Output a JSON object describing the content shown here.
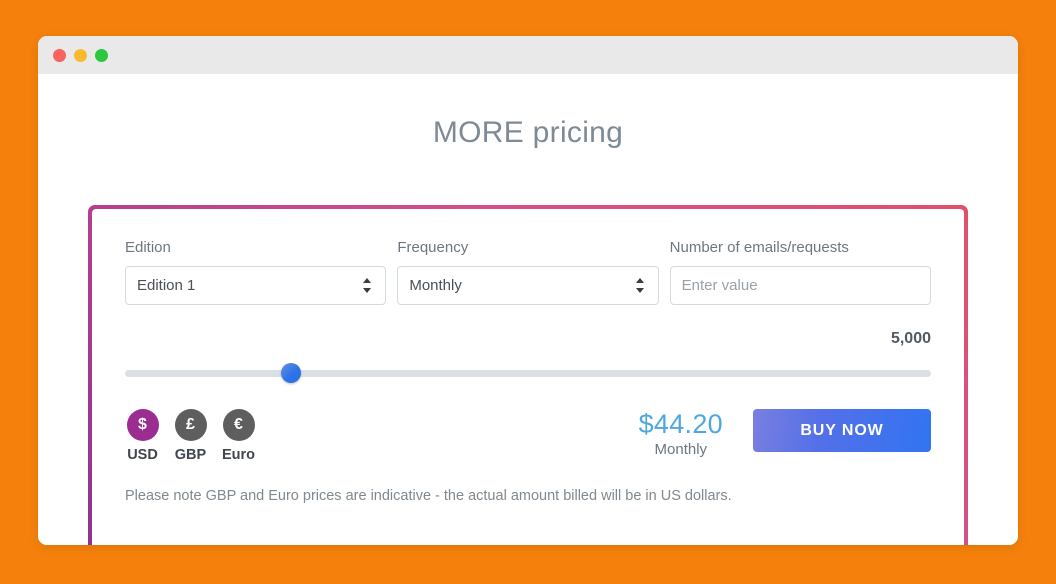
{
  "background_color": "#F5810C",
  "window": {
    "traffic_lights": [
      {
        "name": "close",
        "color": "#f9625e"
      },
      {
        "name": "minimize",
        "color": "#f9bb2d"
      },
      {
        "name": "zoom",
        "color": "#2cc63f"
      }
    ]
  },
  "page": {
    "title": "MORE pricing"
  },
  "card": {
    "border_gradient": [
      "#e0516b",
      "#8e3290"
    ],
    "fields": [
      {
        "label": "Edition",
        "type": "select",
        "value": "Edition 1",
        "icon": "updown-chevron-icon"
      },
      {
        "label": "Frequency",
        "type": "select",
        "value": "Monthly",
        "icon": "updown-chevron-icon"
      },
      {
        "label": "Number of emails/requests",
        "type": "text",
        "value": "",
        "placeholder": "Enter value"
      }
    ],
    "slider": {
      "value_label": "5,000",
      "thumb_percent": 20.6,
      "track_color": "#dcdfe3",
      "thumb_color": "#2f73e8"
    },
    "currencies": [
      {
        "code": "USD",
        "symbol": "$",
        "active": true,
        "color": "#9b2d90"
      },
      {
        "code": "GBP",
        "symbol": "£",
        "active": false,
        "color": "#5e5e5e"
      },
      {
        "code": "Euro",
        "symbol": "€",
        "active": false,
        "color": "#5e5e5e"
      }
    ],
    "price": {
      "amount": "$44.20",
      "period": "Monthly",
      "color": "#4fa7e0"
    },
    "buy_button": {
      "label": "BUY NOW",
      "gradient": [
        "#7a7fe0",
        "#3174f2"
      ]
    },
    "note": "Please note GBP and Euro prices are indicative - the actual amount billed will be in US dollars."
  }
}
